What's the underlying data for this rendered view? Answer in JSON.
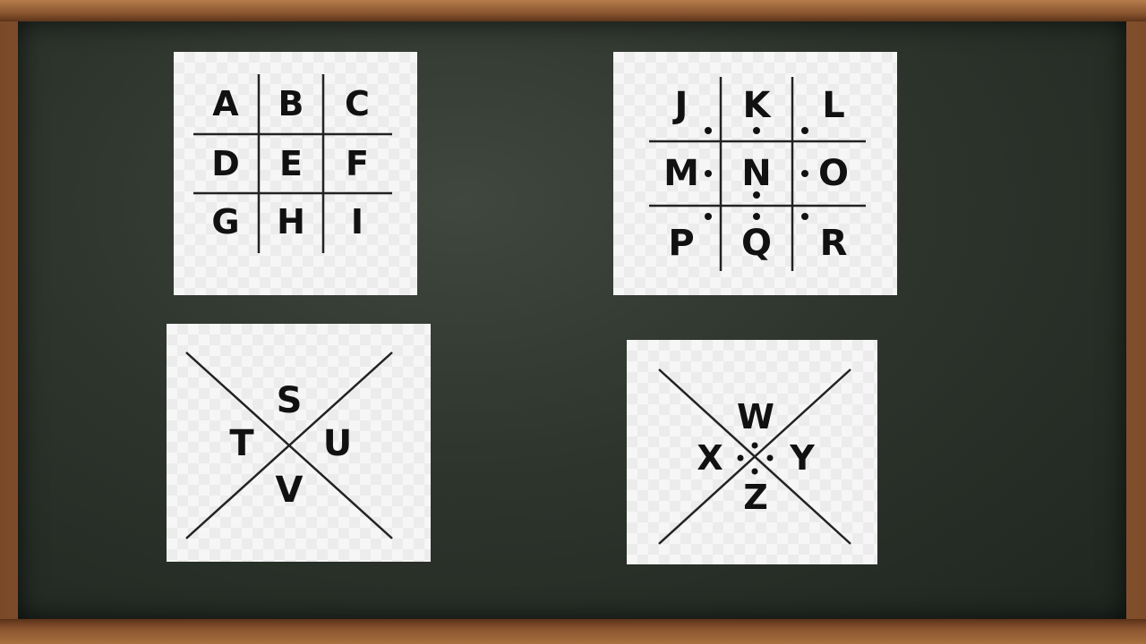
{
  "grid1": {
    "letters": [
      "A",
      "B",
      "C",
      "D",
      "E",
      "F",
      "G",
      "H",
      "I"
    ]
  },
  "grid2": {
    "letters": [
      "J",
      "K",
      "L",
      "M",
      "N",
      "O",
      "P",
      "Q",
      "R"
    ]
  },
  "cross1": {
    "letters": {
      "top": "S",
      "left": "T",
      "right": "U",
      "bottom": "V"
    }
  },
  "cross2": {
    "letters": {
      "top": "W",
      "left": "X",
      "right": "Y",
      "bottom": "Z"
    }
  }
}
